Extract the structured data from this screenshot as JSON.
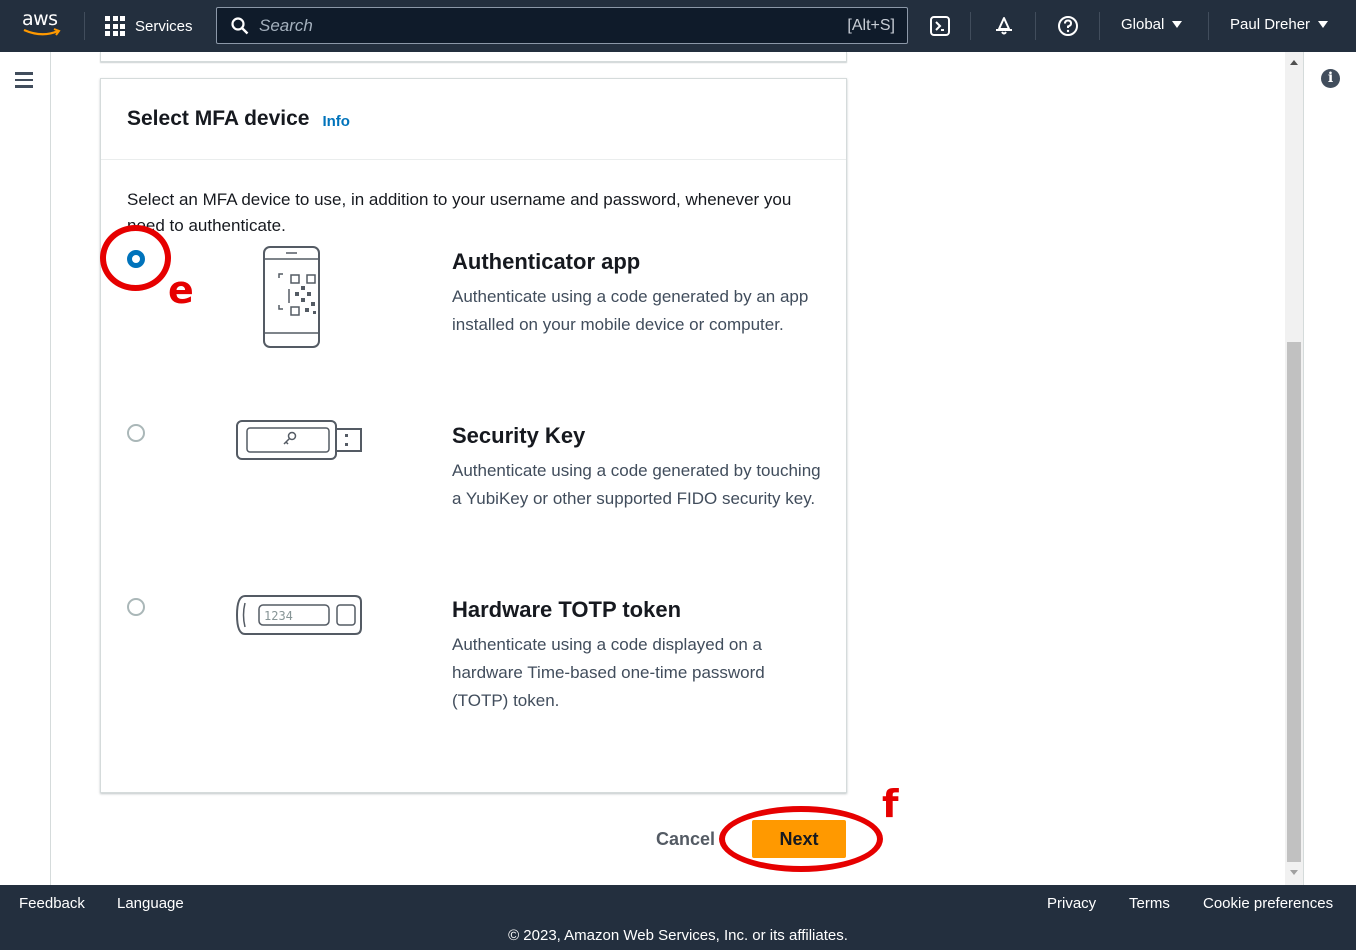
{
  "topnav": {
    "logo_text": "aws",
    "services_label": "Services",
    "search_placeholder": "Search",
    "search_shortcut": "[Alt+S]",
    "region": "Global",
    "user": "Paul Dreher"
  },
  "card": {
    "title": "Select MFA device",
    "info_link": "Info",
    "description": "Select an MFA device to use, in addition to your username and password, whenever you need to authenticate.",
    "options": [
      {
        "title": "Authenticator app",
        "description": "Authenticate using a code generated by an app installed on your mobile device or computer.",
        "selected": true,
        "icon": "phone-qr-icon"
      },
      {
        "title": "Security Key",
        "description": "Authenticate using a code generated by touching a YubiKey or other supported FIDO security key.",
        "selected": false,
        "icon": "usb-security-key-icon"
      },
      {
        "title": "Hardware TOTP token",
        "description": "Authenticate using a code displayed on a hardware Time-based one-time password (TOTP) token.",
        "selected": false,
        "icon": "totp-token-icon",
        "token_display": "1234"
      }
    ]
  },
  "actions": {
    "cancel_label": "Cancel",
    "next_label": "Next"
  },
  "annotations": {
    "e_label": "e",
    "f_label": "f",
    "color": "#e60000"
  },
  "footer": {
    "feedback": "Feedback",
    "language": "Language",
    "privacy": "Privacy",
    "terms": "Terms",
    "cookie_preferences": "Cookie preferences",
    "copyright": "© 2023, Amazon Web Services, Inc. or its affiliates."
  },
  "colors": {
    "nav_bg": "#232f3e",
    "primary_button": "#ff9900",
    "link": "#0073bb",
    "radio_selected": "#0073bb"
  }
}
